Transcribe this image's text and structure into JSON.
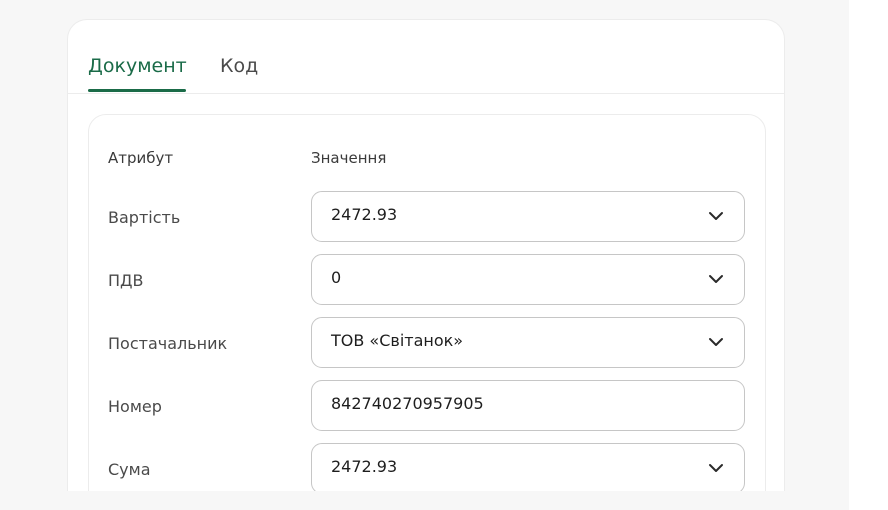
{
  "tabs": [
    {
      "label": "Документ",
      "active": true
    },
    {
      "label": "Код",
      "active": false
    }
  ],
  "table": {
    "header_attribute": "Атрибут",
    "header_value": "Значення",
    "rows": [
      {
        "label": "Вартість",
        "value": "2472.93",
        "dropdown": true
      },
      {
        "label": "ПДВ",
        "value": "0",
        "dropdown": true
      },
      {
        "label": "Постачальник",
        "value": "ТОВ «Світанок»",
        "dropdown": true
      },
      {
        "label": "Номер",
        "value": "842740270957905",
        "dropdown": false
      },
      {
        "label": "Сума",
        "value": "2472.93",
        "dropdown": true
      }
    ]
  },
  "colors": {
    "accent": "#1a6b48",
    "border": "#c6c6c6",
    "background": "#f7f7f7"
  },
  "icons": {
    "dropdown": "chevron-down-icon"
  }
}
